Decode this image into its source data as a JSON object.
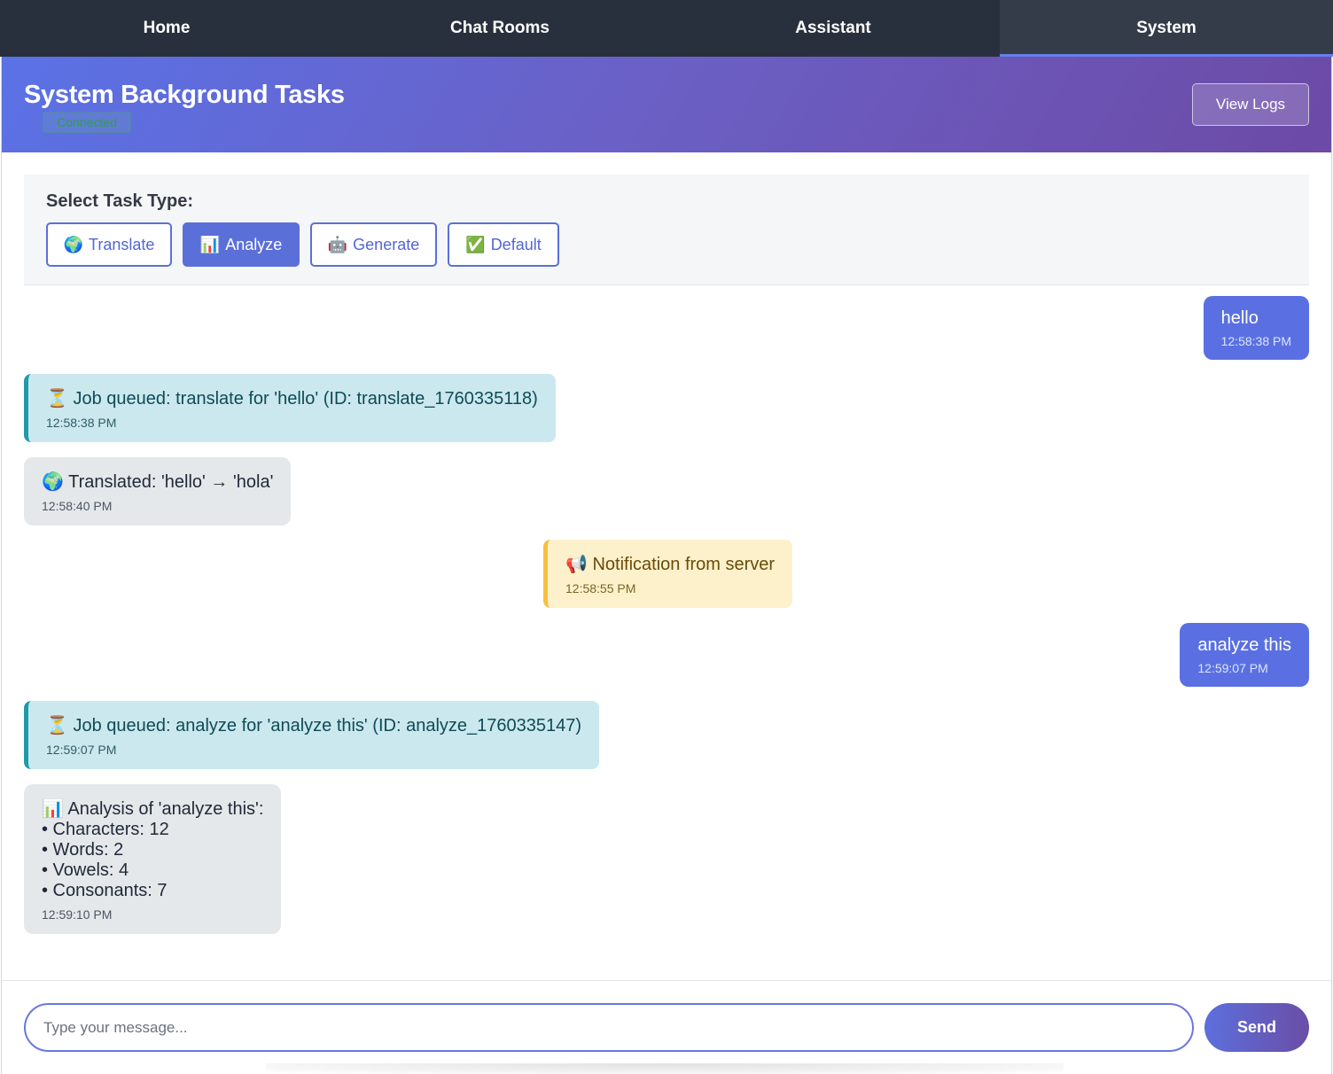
{
  "nav": {
    "tabs": [
      {
        "label": "Home"
      },
      {
        "label": "Chat Rooms"
      },
      {
        "label": "Assistant"
      },
      {
        "label": "System",
        "active": true
      }
    ]
  },
  "header": {
    "title": "System Background Tasks",
    "status": "Connected",
    "view_logs_label": "View Logs"
  },
  "task_selector": {
    "label": "Select Task Type:",
    "options": [
      {
        "emoji": "🌍",
        "label": "Translate"
      },
      {
        "emoji": "📊",
        "label": "Analyze",
        "selected": true
      },
      {
        "emoji": "🤖",
        "label": "Generate"
      },
      {
        "emoji": "✅",
        "label": "Default"
      }
    ]
  },
  "messages": [
    {
      "kind": "user",
      "text": "hello",
      "time": "12:58:38 PM"
    },
    {
      "kind": "queued",
      "text": "⏳ Job queued: translate for 'hello' (ID: translate_1760335118)",
      "time": "12:58:38 PM"
    },
    {
      "kind": "result",
      "text": "🌍 Translated: 'hello' → 'hola'",
      "time": "12:58:40 PM"
    },
    {
      "kind": "notification",
      "text": "📢 Notification from server",
      "time": "12:58:55 PM"
    },
    {
      "kind": "user",
      "text": "analyze this",
      "time": "12:59:07 PM"
    },
    {
      "kind": "queued",
      "text": "⏳ Job queued: analyze for 'analyze this' (ID: analyze_1760335147)",
      "time": "12:59:07 PM"
    },
    {
      "kind": "result",
      "text": "📊 Analysis of 'analyze this':\n• Characters: 12\n• Words: 2\n• Vowels: 4\n• Consonants: 7",
      "time": "12:59:10 PM"
    }
  ],
  "composer": {
    "placeholder": "Type your message...",
    "send_label": "Send"
  },
  "colors": {
    "nav_bg": "#29303d",
    "accent": "#5a70e2",
    "header_gradient_start": "#5a72e6",
    "header_gradient_end": "#6c4aa6",
    "queued_bg": "#cbe8ee",
    "notification_bg": "#fdf1cb",
    "result_bg": "#e5e8eb"
  }
}
